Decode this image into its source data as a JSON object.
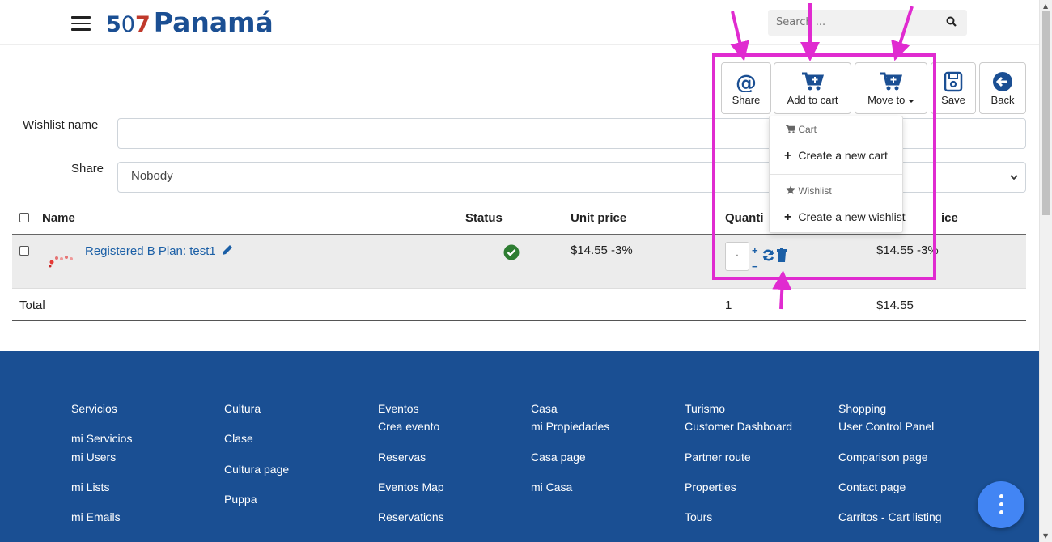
{
  "header": {
    "logo_5": "5",
    "logo_0": "0",
    "logo_7": "7",
    "logo_name": "Panamá",
    "search_placeholder": "Search ..."
  },
  "toolbar": {
    "share": "Share",
    "add_to_cart": "Add to cart",
    "move_to": "Move to",
    "save": "Save",
    "back": "Back"
  },
  "form": {
    "wishlist_name_label": "Wishlist name",
    "wishlist_name_value": "",
    "share_label": "Share",
    "share_value": "Nobody"
  },
  "table": {
    "headers": {
      "name": "Name",
      "status": "Status",
      "unit_price": "Unit price",
      "quantity": "Quanti",
      "price": "ice"
    },
    "rows": [
      {
        "name": "Registered B Plan: test1",
        "unit_price": "$14.55 -3%",
        "quantity": "·",
        "price": "$14.55 -3%"
      }
    ],
    "total_label": "Total",
    "total_quantity": "1",
    "total_price": "$14.55"
  },
  "dropdown": {
    "cart_header": "Cart",
    "create_cart": "Create a new cart",
    "wishlist_header": "Wishlist",
    "create_wishlist": "Create a new wishlist"
  },
  "footer": {
    "columns": [
      [
        "Servicios",
        "mi Servicios",
        "mi Users",
        "mi Lists",
        "mi Emails"
      ],
      [
        "Cultura",
        "Clase",
        "Cultura page",
        "Puppa"
      ],
      [
        "Eventos",
        "Crea evento",
        "Reservas",
        "Eventos Map",
        "Reservations"
      ],
      [
        "Casa",
        "mi Propiedades",
        "Casa page",
        "mi Casa"
      ],
      [
        "Turismo",
        "Customer Dashboard",
        "Partner route",
        "Properties",
        "Tours"
      ],
      [
        "Shopping",
        "User Control Panel",
        "Comparison page",
        "Contact page",
        "Carritos - Cart listing"
      ]
    ]
  },
  "colors": {
    "brand_blue": "#1b4f93",
    "brand_red": "#c0392b",
    "annotation": "#e02bd0",
    "link": "#1b5fa6",
    "status_ok": "#2e7d32",
    "fab": "#4285f4"
  }
}
